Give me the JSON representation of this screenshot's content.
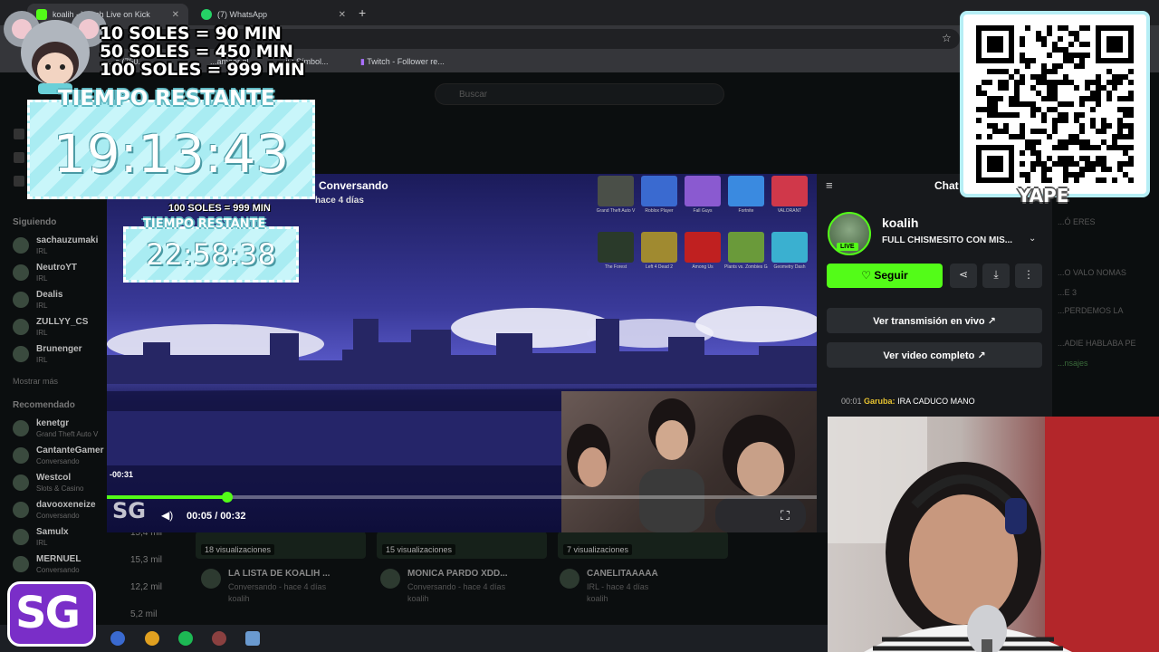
{
  "browser": {
    "tabs": [
      {
        "label": "koalih - Watch Live on Kick",
        "color": "#53fc18"
      },
      {
        "label": "(7) WhatsApp",
        "color": "#25d366"
      }
    ],
    "bookmarks": [
      "...s (750...",
      "...ameer gl...",
      "...ii : Símbol...",
      "Twitch - Follower re..."
    ]
  },
  "overlay": {
    "donations": [
      "10 SOLES = 90 MIN",
      "50 SOLES = 450 MIN",
      "100 SOLES = 999 MIN"
    ],
    "timer_label": "TIEMPO RESTANTE",
    "timer_value": "19:13:43",
    "qr_label": "YAPE",
    "sg_logo": "SG"
  },
  "kick": {
    "search_placeholder": "Buscar",
    "sidebar": {
      "following_heading": "Siguiendo",
      "following": [
        {
          "name": "sachauzumaki",
          "cat": "IRL"
        },
        {
          "name": "NeutroYT",
          "cat": "IRL"
        },
        {
          "name": "Dealis",
          "cat": "IRL"
        },
        {
          "name": "ZULLYY_CS",
          "cat": "IRL"
        },
        {
          "name": "Brunenger",
          "cat": "IRL"
        }
      ],
      "show_more": "Mostrar más",
      "recommended_heading": "Recomendado",
      "recommended": [
        {
          "name": "kenetgr",
          "cat": "Grand Theft Auto V",
          "views": ""
        },
        {
          "name": "CantanteGamer",
          "cat": "Conversando",
          "views": ""
        },
        {
          "name": "Westcol",
          "cat": "Slots & Casino",
          "views": ""
        },
        {
          "name": "davooxeneize",
          "cat": "Conversando",
          "views": "15,4 mil"
        },
        {
          "name": "Samulx",
          "cat": "IRL",
          "views": "15,3 mil"
        },
        {
          "name": "MERNUEL",
          "cat": "Conversando",
          "views": "12,2 mil"
        },
        {
          "name": "",
          "cat": "",
          "views": "5,2 mil"
        }
      ]
    },
    "cards": [
      {
        "badge": "18 visualizaciones",
        "title": "LA LISTA DE KOALIH ...",
        "sub": "Conversando - hace 4 días",
        "user": "koalih"
      },
      {
        "badge": "15 visualizaciones",
        "title": "MONICA PARDO XDD...",
        "sub": "Conversando - hace 4 días",
        "user": "koalih"
      },
      {
        "badge": "7 visualizaciones",
        "title": "CANELITAAAAA",
        "sub": "IRL - hace 4 días",
        "user": "koalih"
      }
    ]
  },
  "modal": {
    "video_title": "Conversando",
    "video_sub": "hace 4 días",
    "inner_donation": "100 SOLES = 999 MIN",
    "inner_timer_label": "TIEMPO RESTANTE",
    "inner_timer_value": "22:58:38",
    "games": [
      {
        "name": "Grand Theft Auto V",
        "color": "#4a4f48"
      },
      {
        "name": "Roblox Player",
        "color": "#3a6ad0"
      },
      {
        "name": "Fall Guys",
        "color": "#8a5ad0"
      },
      {
        "name": "Fortnite",
        "color": "#3a8ae0"
      },
      {
        "name": "VALORANT",
        "color": "#d0384a"
      },
      {
        "name": "The Forest",
        "color": "#2a3a2a"
      },
      {
        "name": "Left 4 Dead 2",
        "color": "#a08a30"
      },
      {
        "name": "Among Us",
        "color": "#c02020"
      },
      {
        "name": "Plants vs. Zombies Game of the Year",
        "color": "#6a9a3a"
      },
      {
        "name": "Geometry Dash",
        "color": "#3ab0d0"
      }
    ],
    "time_remaining": "-00:31",
    "current_time": "00:05 / 00:32",
    "progress": 0.17,
    "panel": {
      "chat_heading": "Chat",
      "streamer": "koalih",
      "live_badge": "LIVE",
      "stream_title": "FULL CHISMESITO CON MIS...",
      "follow_label": "Seguir",
      "watch_live": "Ver transmisión en vivo",
      "watch_full": "Ver video completo",
      "chat": {
        "time": "00:01",
        "user": "Garuba:",
        "msg": "IRA CADUCO MANO"
      }
    }
  },
  "bg_right": [
    "...Ó ERES",
    "...O VALO NOMAS",
    "...E 3",
    "...PERDEMOS LA",
    "...ADIE HABLABA PE",
    "...nsajes"
  ],
  "colors": {
    "accent": "#53fc18",
    "timer": "#a9ecf2",
    "sg": "#7a2ec8"
  }
}
